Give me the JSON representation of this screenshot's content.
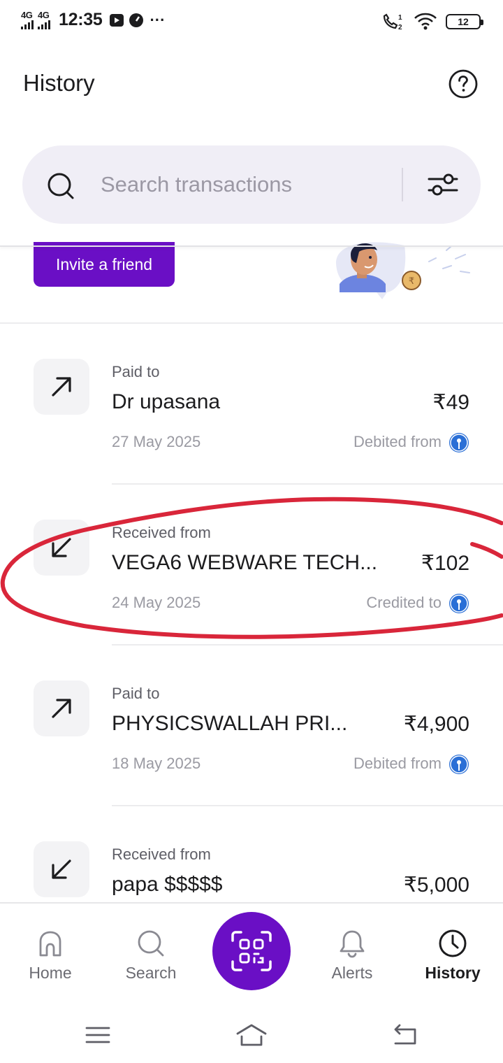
{
  "status_bar": {
    "network1": "4G",
    "network2": "4G",
    "time": "12:35",
    "more": "···",
    "battery": "12"
  },
  "header": {
    "title": "History",
    "help_icon": "help-circle-icon"
  },
  "search": {
    "placeholder": "Search transactions",
    "icon": "search-icon",
    "filter_icon": "sliders-icon"
  },
  "promo": {
    "invite_label": "Invite a friend"
  },
  "transactions": [
    {
      "direction": "out",
      "type": "Paid to",
      "name": "Dr upasana",
      "amount": "₹49",
      "date": "27 May 2025",
      "account_label": "Debited from"
    },
    {
      "direction": "in",
      "type": "Received from",
      "name": "VEGA6 WEBWARE TECH...",
      "amount": "₹102",
      "date": "24 May 2025",
      "account_label": "Credited to"
    },
    {
      "direction": "out",
      "type": "Paid to",
      "name": "PHYSICSWALLAH PRI...",
      "amount": "₹4,900",
      "date": "18 May 2025",
      "account_label": "Debited from"
    },
    {
      "direction": "in",
      "type": "Received from",
      "name": "papa $$$$$",
      "amount": "₹5,000",
      "date": "",
      "account_label": ""
    }
  ],
  "bottom_nav": {
    "home": "Home",
    "search": "Search",
    "alerts": "Alerts",
    "history": "History",
    "active": "History"
  },
  "colors": {
    "brand": "#6a0fc5",
    "annotation": "#d9263a",
    "bank_logo": "#2a6fd6"
  }
}
